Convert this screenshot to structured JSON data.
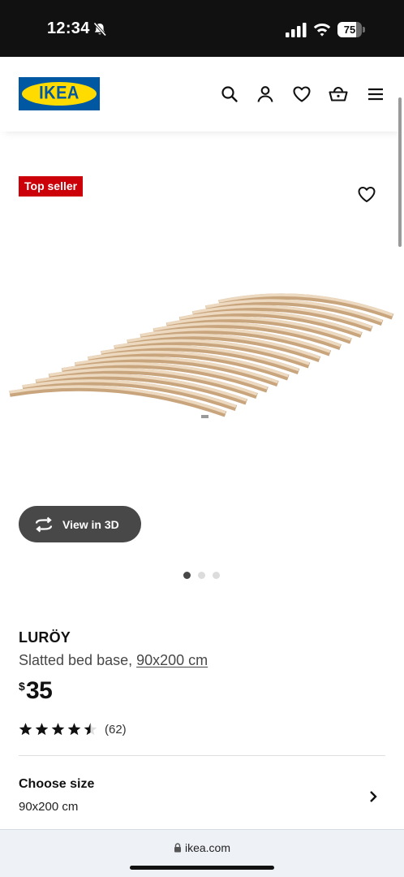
{
  "status_bar": {
    "time": "12:34",
    "battery_level": 75,
    "battery_label": "75",
    "icons": [
      "bell-slash-icon",
      "signal-icon",
      "wifi-icon",
      "battery-icon"
    ]
  },
  "header": {
    "logo_text": "IKEA",
    "brand_colors": {
      "blue": "#0058a3",
      "yellow": "#ffdb00"
    },
    "icons": [
      "search-icon",
      "user-icon",
      "heart-icon",
      "basket-icon",
      "menu-icon"
    ]
  },
  "product": {
    "badge": "Top seller",
    "badge_color": "#cc0008",
    "view_3d_label": "View in 3D",
    "carousel": {
      "total": 3,
      "active": 1
    },
    "name": "LURÖY",
    "description": "Slatted bed base, ",
    "size_link": "90x200 cm",
    "currency": "$",
    "price": "35",
    "rating": 4.5,
    "rating_max": 5,
    "review_count": "(62)"
  },
  "size_selector": {
    "title": "Choose size",
    "value": "90x200 cm"
  },
  "browser": {
    "url": "ikea.com"
  }
}
